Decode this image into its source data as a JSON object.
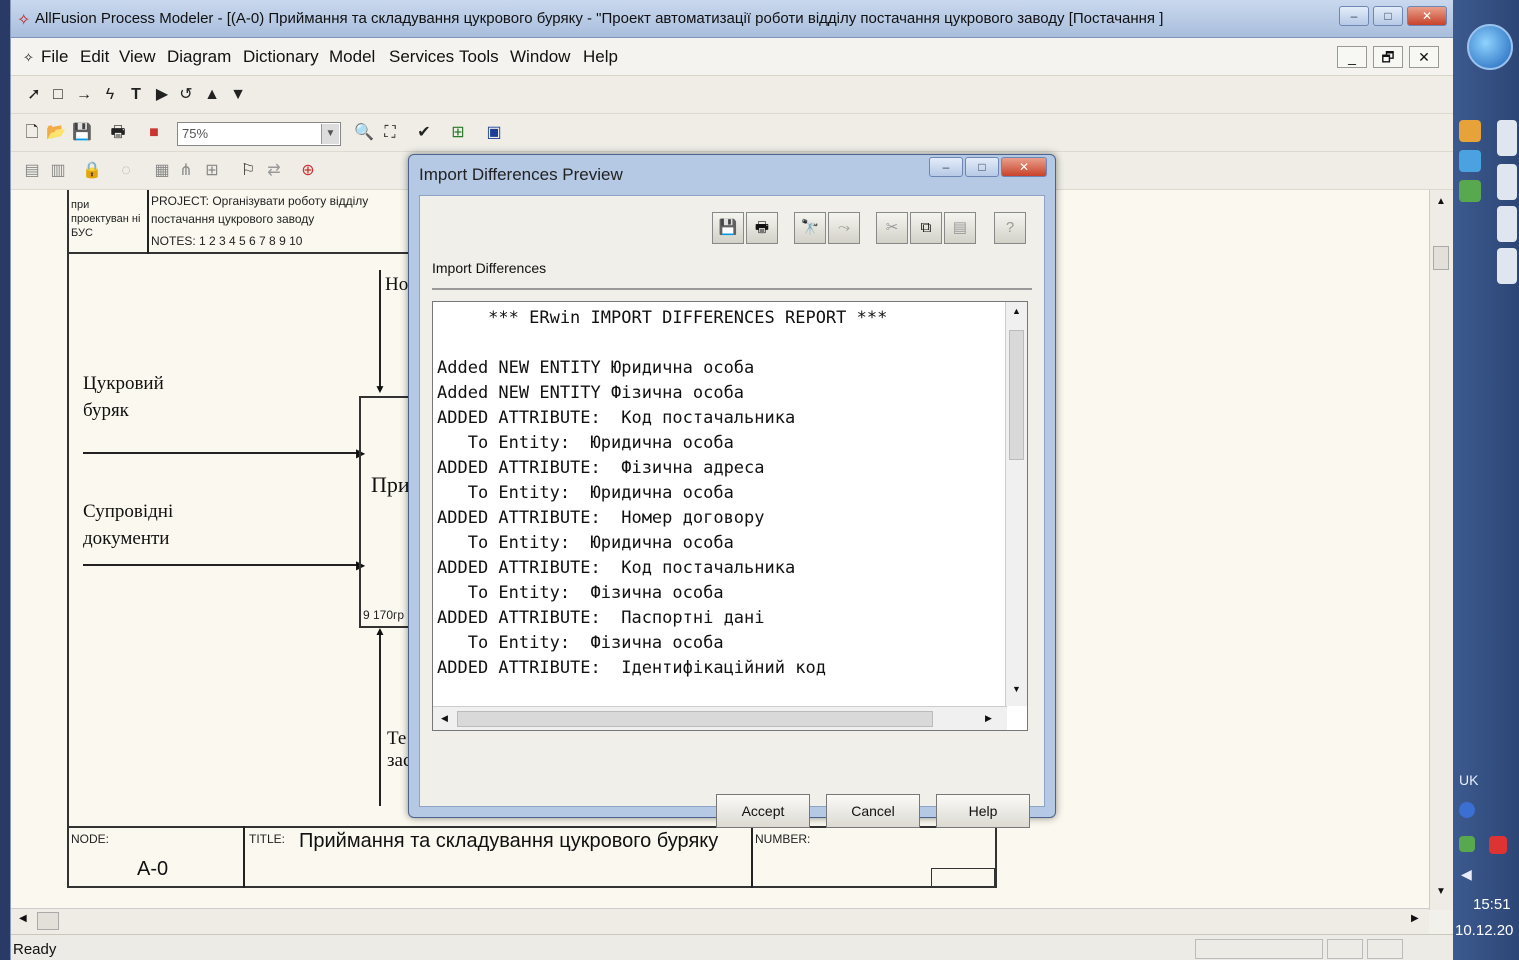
{
  "window": {
    "title": "AllFusion Process Modeler - [(A-0) Приймання та складування  цукрового буряку - \"Проект автоматизації роботи відділу постачання цукрового заводу  [Постачання ]",
    "min": "–",
    "max": "□",
    "close": "✕"
  },
  "menu": [
    "File",
    "Edit",
    "View",
    "Diagram",
    "Dictionary",
    "Model",
    "Services",
    "Tools",
    "Window",
    "Help"
  ],
  "mdi_buttons": [
    "_",
    "🗗",
    "✕"
  ],
  "toolbar": {
    "zoom_value": "75%"
  },
  "diagram": {
    "header": {
      "used_at": "при проектуван ні БУС",
      "project": "PROJECT:  Організувати роботу відділу постачання цукрового заводу",
      "notes": "NOTES:  1  2  3  4  5  6  7  8  9  10"
    },
    "inputs": [
      "Цукровий буряк",
      "Супровідні документи"
    ],
    "control_partial": "Но",
    "box_label_partial": "При",
    "cost_partial": "9 170гр",
    "mechanism_partial": "Те зас",
    "footer": {
      "node_label": "NODE:",
      "node_value": "A-0",
      "title_label": "TITLE:",
      "title_value": "Приймання та складування  цукрового буряку",
      "number_label": "NUMBER:"
    }
  },
  "dialog": {
    "title": "Import Differences Preview",
    "section_label": "Import Differences",
    "report_lines": [
      "     *** ERwin IMPORT DIFFERENCES REPORT ***",
      "",
      "Added NEW ENTITY Юридична особа",
      "Added NEW ENTITY Фізична особа",
      "ADDED ATTRIBUTE:  Код постачальника",
      "   To Entity:  Юридична особа",
      "ADDED ATTRIBUTE:  Фізична адреса",
      "   To Entity:  Юридична особа",
      "ADDED ATTRIBUTE:  Номер договору",
      "   To Entity:  Юридична особа",
      "ADDED ATTRIBUTE:  Код постачальника",
      "   To Entity:  Фізична особа",
      "ADDED ATTRIBUTE:  Паспортні дані",
      "   To Entity:  Фізична особа",
      "ADDED ATTRIBUTE:  Ідентифікаційний код"
    ],
    "buttons": {
      "accept": "Accept",
      "cancel": "Cancel",
      "help": "Help"
    }
  },
  "status": {
    "text": "Ready"
  },
  "taskbar": {
    "lang": "UK",
    "time": "15:51",
    "date": "10.12.20"
  }
}
